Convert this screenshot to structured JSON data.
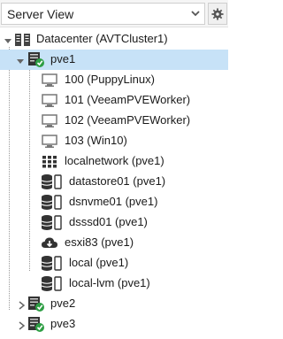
{
  "header": {
    "view_selector": {
      "value": "Server View",
      "icon": "chevron-down-icon"
    },
    "settings_icon": "gear-icon"
  },
  "tree": {
    "datacenter": {
      "label": "Datacenter (AVTCluster1)",
      "expanded": true,
      "icon": "datacenter-icon"
    },
    "nodes": [
      {
        "label": "pve1",
        "expanded": true,
        "selected": true,
        "status": "online",
        "children": [
          {
            "label": "100 (PuppyLinux)",
            "icon": "vm-icon"
          },
          {
            "label": "101 (VeeamPVEWorker)",
            "icon": "vm-icon"
          },
          {
            "label": "102 (VeeamPVEWorker)",
            "icon": "vm-icon"
          },
          {
            "label": "103 (Win10)",
            "icon": "vm-icon"
          },
          {
            "label": "localnetwork (pve1)",
            "icon": "network-grid-icon"
          },
          {
            "label": "datastore01 (pve1)",
            "icon": "storage-icon"
          },
          {
            "label": "dsnvme01 (pve1)",
            "icon": "storage-icon"
          },
          {
            "label": "dsssd01 (pve1)",
            "icon": "storage-icon"
          },
          {
            "label": "esxi83 (pve1)",
            "icon": "cloud-download-icon"
          },
          {
            "label": "local (pve1)",
            "icon": "storage-icon"
          },
          {
            "label": "local-lvm (pve1)",
            "icon": "storage-icon"
          }
        ]
      },
      {
        "label": "pve2",
        "expanded": false,
        "selected": false,
        "status": "online"
      },
      {
        "label": "pve3",
        "expanded": false,
        "selected": false,
        "status": "online"
      }
    ]
  },
  "colors": {
    "selection": "#c7e2f7",
    "online_badge": "#2e9e44",
    "icon_gray": "#5a5a5a"
  }
}
